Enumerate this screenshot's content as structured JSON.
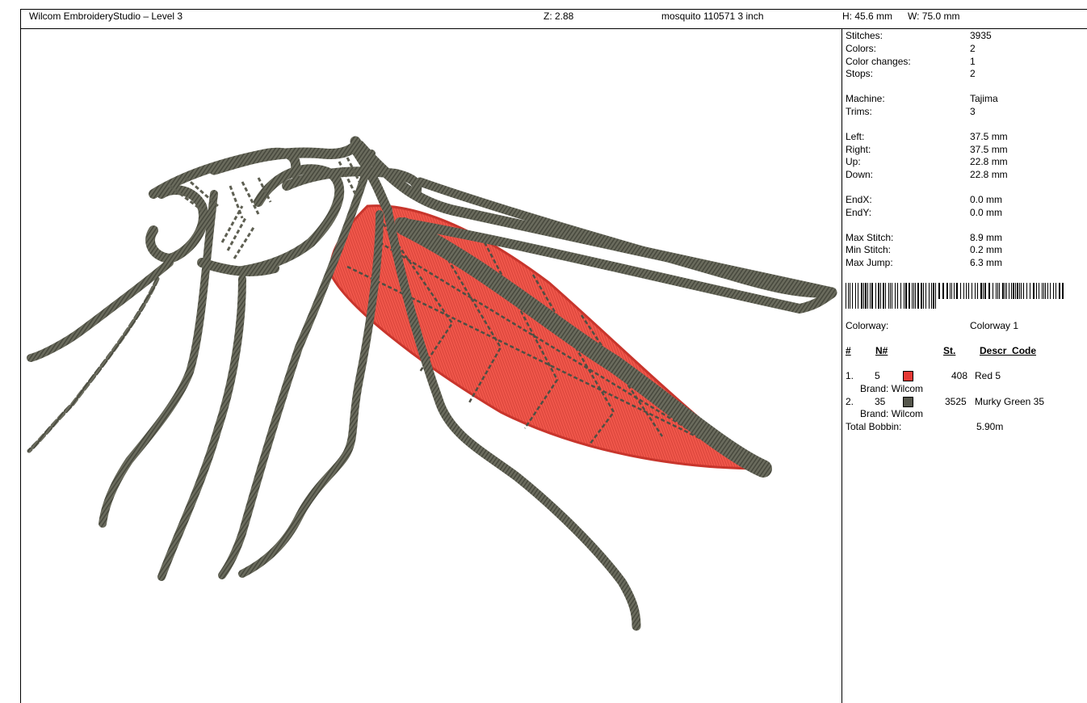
{
  "header": {
    "title": "Wilcom EmbroideryStudio – Level 3",
    "zoom": "Z: 2.88",
    "design_name": "mosquito 110571 3 inch",
    "height": "H: 45.6 mm",
    "width": "W: 75.0 mm"
  },
  "stats": {
    "stitches_label": "Stitches:",
    "stitches": "3935",
    "colors_label": "Colors:",
    "colors": "2",
    "color_changes_label": "Color changes:",
    "color_changes": "1",
    "stops_label": "Stops:",
    "stops": "2",
    "machine_label": "Machine:",
    "machine": "Tajima",
    "trims_label": "Trims:",
    "trims": "3",
    "left_label": "Left:",
    "left": "37.5 mm",
    "right_label": "Right:",
    "right": "37.5 mm",
    "up_label": "Up:",
    "up": "22.8 mm",
    "down_label": "Down:",
    "down": "22.8 mm",
    "endx_label": "EndX:",
    "endx": "0.0 mm",
    "endy_label": "EndY:",
    "endy": "0.0 mm",
    "max_stitch_label": "Max Stitch:",
    "max_stitch": "8.9 mm",
    "min_stitch_label": "Min Stitch:",
    "min_stitch": "0.2 mm",
    "max_jump_label": "Max Jump:",
    "max_jump": "6.3 mm"
  },
  "colorway": {
    "label": "Colorway:",
    "value": "Colorway 1",
    "columns": {
      "index": "#",
      "number": "N#",
      "stitches": "St.",
      "description": "Descr_Code"
    },
    "threads": [
      {
        "index": "1.",
        "number": "5",
        "color": "#e53935",
        "stitches": "408",
        "description": "Red 5",
        "brand": "Brand: Wilcom"
      },
      {
        "index": "2.",
        "number": "35",
        "color": "#55564c",
        "stitches": "3525",
        "description": "Murky Green 35",
        "brand": "Brand: Wilcom"
      }
    ],
    "bobbin_label": "Total Bobbin:",
    "bobbin": "5.90m"
  },
  "design_colors": {
    "thread_green": "#5e5f52",
    "thread_green_dark": "#45463b",
    "thread_red": "#ef5146",
    "thread_red_dark": "#c8352c"
  }
}
